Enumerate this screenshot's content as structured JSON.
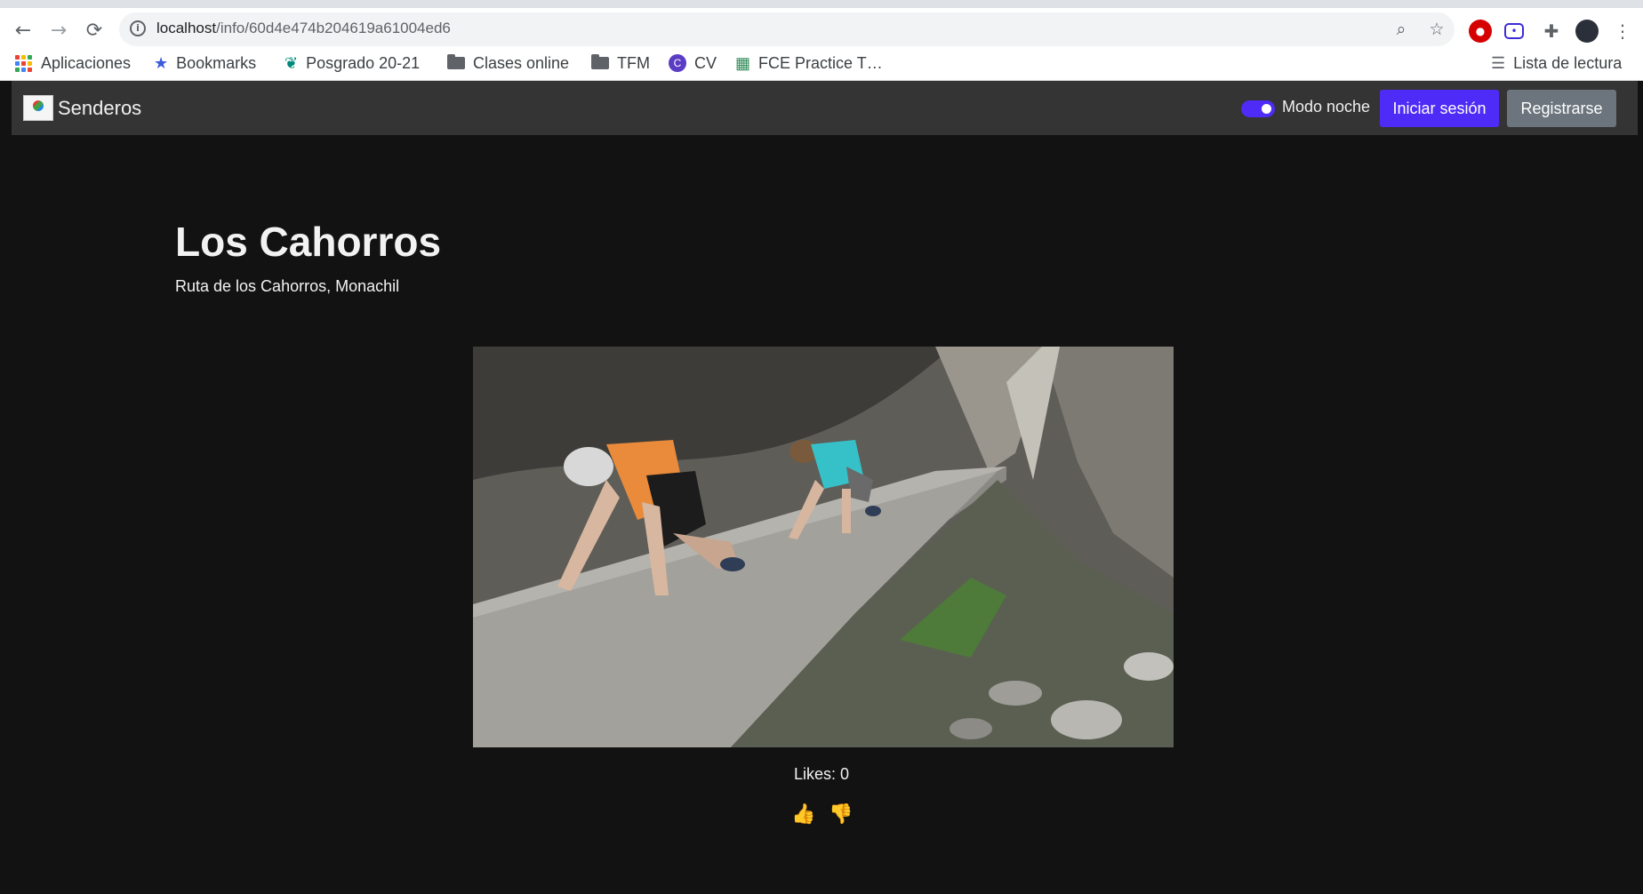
{
  "browser": {
    "url_host": "localhost",
    "url_path": "/info/60d4e474b204619a61004ed6",
    "bookmarks": [
      {
        "label": "Aplicaciones",
        "icon": "apps-grid-icon"
      },
      {
        "label": "Bookmarks",
        "icon": "star-icon"
      },
      {
        "label": "Posgrado 20-21",
        "icon": "leaf-icon"
      },
      {
        "label": "Clases online",
        "icon": "folder-icon"
      },
      {
        "label": "TFM",
        "icon": "folder-icon"
      },
      {
        "label": "CV",
        "icon": "canva-icon"
      },
      {
        "label": "FCE Practice T…",
        "icon": "quiz-icon"
      }
    ],
    "reading_list": "Lista de lectura"
  },
  "navbar": {
    "brand": "Senderos",
    "night_mode_label": "Modo noche",
    "night_mode_on": true,
    "login": "Iniciar sesión",
    "register": "Registrarse"
  },
  "route": {
    "title": "Los Cahorros",
    "subtitle": "Ruta de los Cahorros, Monachil",
    "likes_text": "Likes: 0",
    "like_icon": "👍",
    "dislike_icon": "👎"
  },
  "colors": {
    "accent": "#4f2bf7",
    "background": "#121212",
    "navbar": "#343434",
    "secondary": "#6c757d"
  }
}
